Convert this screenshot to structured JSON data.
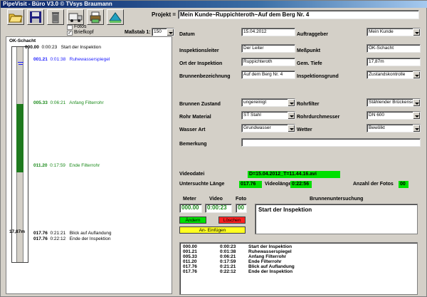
{
  "window": {
    "title": "PipeVisit - Büro   V3.0    © TVsys Braumann"
  },
  "toolbar": {
    "fotos_label": "Fotos",
    "briefkopf_label": "Briefkopf",
    "massstab_label": "Maßstab 1:",
    "massstab_value": "150"
  },
  "header": {
    "projekt_label": "Projekt =",
    "projekt_value": "Mein Kunde~Ruppichteroth~Auf dem Berg Nr. 4"
  },
  "form": {
    "datum_label": "Datum",
    "datum_value": "15.04.2012",
    "auftraggeber_label": "Auftraggeber",
    "auftraggeber_value": "Mein Kunde",
    "inspektionsleiter_label": "Inspektionsleiter",
    "inspektionsleiter_value": "Der Leiter",
    "messpunkt_label": "Meßpunkt",
    "messpunkt_value": "OK-Schacht",
    "ort_label": "Ort der Inspektion",
    "ort_value": "Ruppichteroth",
    "tiefe_label": "Gem. Tiefe",
    "tiefe_value": "17,87m",
    "brunnen_label": "Brunnenbezeichnung",
    "brunnen_value": "Auf dem Berg Nr. 4",
    "grund_label": "Inspektionsgrund",
    "grund_value": "Zustandskontrolle",
    "zustand_label": "Brunnen Zustand",
    "zustand_value": "ungereinigt",
    "rohfilter_label": "Rohrfilter",
    "rohfilter_value": "Stählender Brückensc",
    "material_label": "Rohr Material",
    "material_value": "ST Stahl",
    "durchmesser_label": "Rohrdurchmesser",
    "durchmesser_value": "DN 600",
    "wasser_label": "Wasser Art",
    "wasser_value": "Grundwasser",
    "wetter_label": "Wetter",
    "wetter_value": "Bewölkt",
    "bemerkung_label": "Bemerkung",
    "bemerkung_value": ""
  },
  "video": {
    "datei_label": "Videodatei",
    "datei_value": "D=15.04.2012_T=11.44.16.avi",
    "laenge_label": "Untersuchte Länge",
    "laenge_value": "017.76",
    "videolaenge_label": "Videolänge",
    "videolaenge_value": "0:22:56",
    "fotos_label": "Anzahl der Fotos",
    "fotos_value": "00"
  },
  "entry": {
    "meter_label": "Meter",
    "meter_value": "000.00",
    "video_label": "Video",
    "video_value": "0:00:23",
    "foto_label": "Foto",
    "foto_value": "00",
    "brunnenunters_label": "Brunnenuntersuchung",
    "note_value": "Start der Inspektion",
    "andern_label": "Ändern",
    "loschen_label": "Löschen",
    "einfugen_label": "An- Einfügen"
  },
  "shaft": {
    "header": "OK-Schacht",
    "total": "17,87m",
    "fill_colors": {
      "filter": "#1f7a1f",
      "water_label": "#1a1aff",
      "filter_label": "#1a8a1a"
    },
    "events": [
      {
        "depth": "000.00",
        "time": "0:00:23",
        "text": "Start der Inspektion"
      },
      {
        "depth": "001.21",
        "time": "0:01:38",
        "text": "Ruhewasserspiegel"
      },
      {
        "depth": "005.33",
        "time": "0:06:21",
        "text": "Anfang Filterrohr"
      },
      {
        "depth": "011.20",
        "time": "0:17:59",
        "text": "Ende Filterrohr"
      },
      {
        "depth": "017.76",
        "time": "0:21:21",
        "text": "Blick auf Auflandung"
      },
      {
        "depth": "017.76",
        "time": "0:22:12",
        "text": "Ende der Inspektion"
      }
    ]
  },
  "log": [
    {
      "depth": "000.00",
      "time": "0:00:23",
      "text": "Start der Inspektion"
    },
    {
      "depth": "001.21",
      "time": "0:01:38",
      "text": "Ruhewasserspiegel"
    },
    {
      "depth": "005.33",
      "time": "0:06:21",
      "text": "Anfang Filterrohr"
    },
    {
      "depth": "011.20",
      "time": "0:17:59",
      "text": "Ende Filterrohr"
    },
    {
      "depth": "017.76",
      "time": "0:21:21",
      "text": "Blick auf Auflandung"
    },
    {
      "depth": "017.76",
      "time": "0:22:12",
      "text": "Ende der Inspektion"
    }
  ]
}
